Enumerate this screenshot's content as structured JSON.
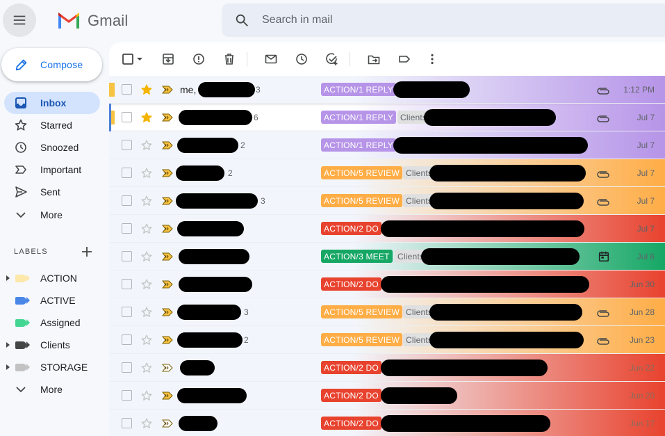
{
  "header": {
    "brand": "Gmail",
    "search_placeholder": "Search in mail"
  },
  "compose_label": "Compose",
  "nav": [
    {
      "label": "Inbox",
      "icon": "inbox-icon",
      "active": true
    },
    {
      "label": "Starred",
      "icon": "star-icon"
    },
    {
      "label": "Snoozed",
      "icon": "clock-icon"
    },
    {
      "label": "Important",
      "icon": "important-icon"
    },
    {
      "label": "Sent",
      "icon": "send-icon"
    },
    {
      "label": "More",
      "icon": "chevron-down-icon"
    }
  ],
  "labels_heading": "LABELS",
  "labels": [
    {
      "label": "ACTION",
      "color": "#fce8a8",
      "expandable": true
    },
    {
      "label": "ACTIVE",
      "color": "#4a86e8",
      "expandable": false
    },
    {
      "label": "Assigned",
      "color": "#43d692",
      "expandable": false
    },
    {
      "label": "Clients",
      "color": "#444746",
      "expandable": true
    },
    {
      "label": "STORAGE",
      "color": "#c2c2c2",
      "expandable": true
    },
    {
      "label": "More",
      "icon": "chevron-down-icon"
    }
  ],
  "colors": {
    "reply": "#b694e8",
    "review": "#ffad46",
    "do": "#e8432e",
    "meet": "#16a765"
  },
  "rows": [
    {
      "sender": "me,",
      "count": "3",
      "chip": "ACTION/1 REPLY",
      "chip_color": "#b694e8",
      "folder": "",
      "attachment": true,
      "date": "1:12 PM",
      "starred": true,
      "unread": true
    },
    {
      "sender": "",
      "count": "6",
      "chip": "ACTION/1 REPLY",
      "chip_color": "#b694e8",
      "folder": "Clients/",
      "attachment": true,
      "date": "Jul 7",
      "starred": true,
      "unread": true
    },
    {
      "sender": "",
      "count": "2",
      "chip": "ACTION/1 REPLY",
      "chip_color": "#b694e8",
      "folder": "",
      "attachment": false,
      "date": "Jul 7",
      "starred": false
    },
    {
      "sender": "",
      "count": "2",
      "chip": "ACTION/5 REVIEW",
      "chip_color": "#ffad46",
      "folder": "Clients",
      "attachment": true,
      "date": "Jul 7",
      "starred": false
    },
    {
      "sender": "",
      "count": "3",
      "chip": "ACTION/5 REVIEW",
      "chip_color": "#ffad46",
      "folder": "Clients",
      "attachment": true,
      "date": "Jul 7",
      "starred": false
    },
    {
      "sender": "",
      "count": "",
      "chip": "ACTION/2 DO",
      "chip_color": "#e8432e",
      "folder": "",
      "attachment": false,
      "date": "Jul 7",
      "starred": false
    },
    {
      "sender": "",
      "count": "",
      "chip": "ACTION/3 MEET",
      "chip_color": "#16a765",
      "folder": "Clients/",
      "attachment": false,
      "calendar": true,
      "date": "Jul 6",
      "starred": false
    },
    {
      "sender": "",
      "count": "",
      "chip": "ACTION/2 DO",
      "chip_color": "#e8432e",
      "folder": "",
      "attachment": false,
      "date": "Jun 30",
      "starred": false
    },
    {
      "sender": "",
      "count": "3",
      "chip": "ACTION/5 REVIEW",
      "chip_color": "#ffad46",
      "folder": "Clients/",
      "attachment": true,
      "date": "Jun 28",
      "starred": false
    },
    {
      "sender": "",
      "count": "2",
      "chip": "ACTION/5 REVIEW",
      "chip_color": "#ffad46",
      "folder": "Clients/",
      "attachment": true,
      "date": "Jun 23",
      "starred": false
    },
    {
      "sender": "",
      "count": "",
      "chip": "ACTION/2 DO",
      "chip_color": "#e8432e",
      "folder": "",
      "attachment": false,
      "date": "Jun 22",
      "starred": false
    },
    {
      "sender": "",
      "count": "",
      "chip": "ACTION/2 DO",
      "chip_color": "#e8432e",
      "folder": "",
      "attachment": false,
      "date": "Jun 20",
      "starred": false
    },
    {
      "sender": "",
      "count": "",
      "chip": "ACTION/2 DO",
      "chip_color": "#e8432e",
      "folder": "",
      "attachment": false,
      "date": "Jun 17",
      "starred": false
    }
  ]
}
